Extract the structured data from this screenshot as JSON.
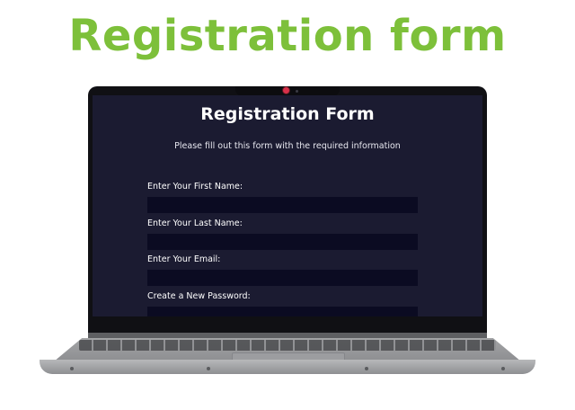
{
  "headline": "Registration form",
  "screen": {
    "title": "Registration Form",
    "subtitle": "Please fill out this form with the required information",
    "fields": [
      {
        "label": "Enter Your First Name:",
        "value": ""
      },
      {
        "label": "Enter Your Last Name:",
        "value": ""
      },
      {
        "label": "Enter Your Email:",
        "value": ""
      },
      {
        "label": "Create a New Password:",
        "value": ""
      }
    ]
  },
  "colors": {
    "headline": "#7dc03a",
    "screen_bg": "#1b1b31",
    "input_bg": "#0b0b22",
    "camera": "#d9304a"
  },
  "icons": {
    "camera": "webcam-icon"
  }
}
